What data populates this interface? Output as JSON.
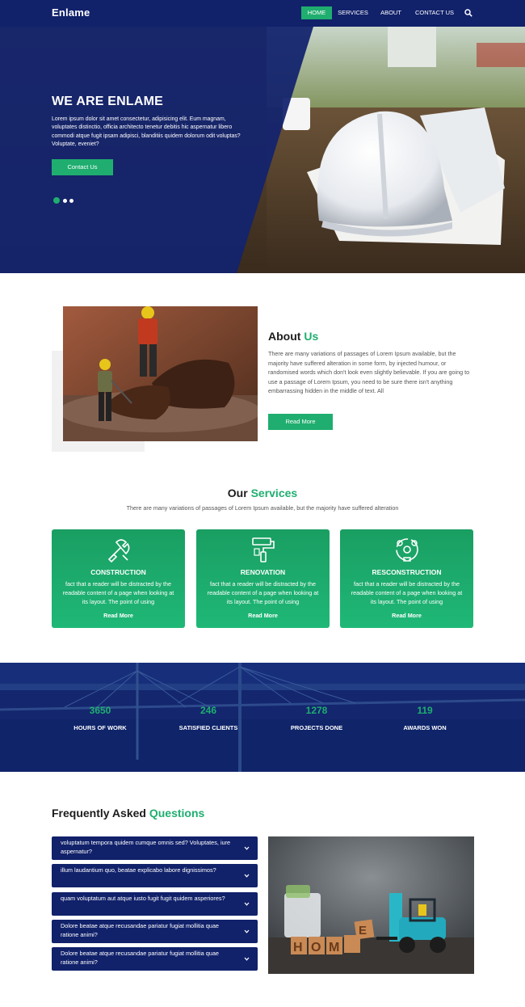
{
  "brand": "Enlame",
  "nav": {
    "items": [
      {
        "label": "HOME",
        "active": true
      },
      {
        "label": "SERVICES",
        "active": false
      },
      {
        "label": "ABOUT",
        "active": false
      },
      {
        "label": "CONTACT US",
        "active": false
      }
    ],
    "search_icon": "search-icon"
  },
  "hero": {
    "title": "WE ARE ENLAME",
    "text": "Lorem ipsum dolor sit amet consectetur, adipisicing elit. Eum magnam, voluptates distinctio, officia architecto tenetur debitis hic aspernatur libero commodi atque fugit ipsam adipisci, blanditiis quidem dolorum odit voluptas? Voluptate, eveniet?",
    "button": "Contact Us",
    "slides": 3,
    "active_slide": 1
  },
  "about": {
    "title_main": "About",
    "title_accent": "Us",
    "text": "There are many variations of passages of Lorem Ipsum available, but the majority have suffered alteration in some form, by injected humour, or randomised words which don't look even slightly believable. If you are going to use a passage of Lorem Ipsum, you need to be sure there isn't anything embarrassing hidden in the middle of text. All",
    "button": "Read More"
  },
  "services": {
    "title_main": "Our",
    "title_accent": "Services",
    "subtitle": "There are many variations of passages of Lorem Ipsum available, but the majority have suffered alteration",
    "cards": [
      {
        "icon": "wrench-tools-icon",
        "title": "CONSTRUCTION",
        "text": "fact that a reader will be distracted by the readable content of a page when looking at its layout. The point of using",
        "link": "Read More"
      },
      {
        "icon": "paint-roller-icon",
        "title": "RENOVATION",
        "text": "fact that a reader will be distracted by the readable content of a page when looking at its layout. The point of using",
        "link": "Read More"
      },
      {
        "icon": "reconstruction-cycle-icon",
        "title": "RESCONSTRUCTION",
        "text": "fact that a reader will be distracted by the readable content of a page when looking at its layout. The point of using",
        "link": "Read More"
      }
    ]
  },
  "stats": [
    {
      "value": "3650",
      "label": "HOURS OF WORK"
    },
    {
      "value": "246",
      "label": "SATISFIED CLIENTS"
    },
    {
      "value": "1278",
      "label": "PROJECTS DONE"
    },
    {
      "value": "119",
      "label": "AWARDS WON"
    }
  ],
  "faq": {
    "title_main": "Frequently Asked",
    "title_accent": "Questions",
    "items": [
      {
        "question": "voluptatum tempora quidem cumque omnis sed? Voluptates, iure aspernatur?"
      },
      {
        "question": "illum laudantium quo, beatae explicabo labore dignissimos?"
      },
      {
        "question": "quam voluptatum aut atque iusto fugit fugit quidem asperiores?"
      },
      {
        "question": "Dolore beatae atque recusandae pariatur fugiat mollitia quae ratione animi?"
      },
      {
        "question": "Dolore beatae atque recusandae pariatur fugiat mollitia quae ratione animi?"
      }
    ],
    "image_letters": "HOME"
  },
  "colors": {
    "navy": "#11216a",
    "green": "#1fae6f",
    "white": "#ffffff"
  }
}
